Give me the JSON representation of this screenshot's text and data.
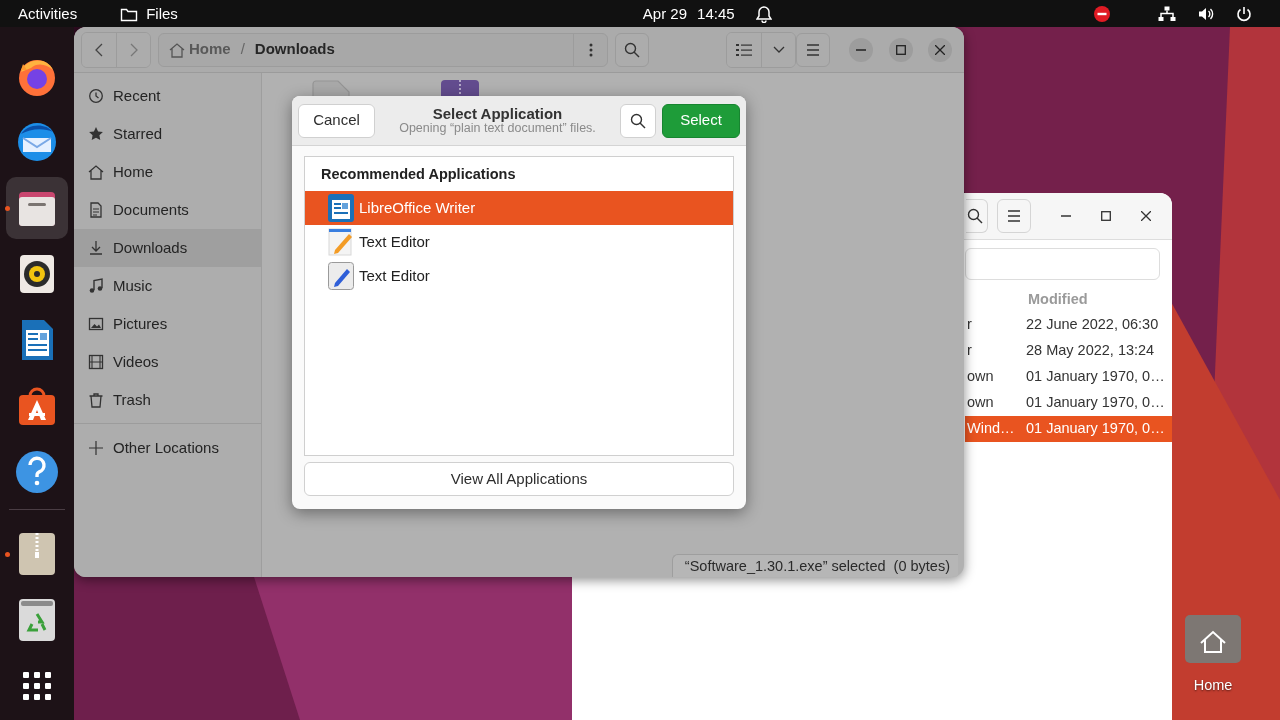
{
  "top_bar": {
    "activities": "Activities",
    "app_menu": "Files",
    "date": "Apr 29",
    "time": "14:45"
  },
  "dock": {
    "pinned": [
      {
        "kind": "browser",
        "running": false,
        "selected": false
      },
      {
        "kind": "mail",
        "running": false,
        "selected": false
      },
      {
        "kind": "files",
        "running": true,
        "selected": true
      },
      {
        "kind": "music",
        "running": false,
        "selected": false
      },
      {
        "kind": "writer",
        "running": false,
        "selected": false
      },
      {
        "kind": "store",
        "running": false,
        "selected": false
      },
      {
        "kind": "help",
        "running": false,
        "selected": false
      }
    ],
    "others": [
      {
        "kind": "archive",
        "running": true,
        "selected": false
      },
      {
        "kind": "trash",
        "running": false,
        "selected": false
      }
    ]
  },
  "files_window": {
    "path": [
      {
        "label": "Home",
        "current": false
      },
      {
        "separator": "/",
        "label": "Downloads",
        "current": true
      }
    ],
    "sidebar": {
      "items": [
        {
          "kind": "recent",
          "label": "Recent",
          "selected": false
        },
        {
          "kind": "starred",
          "label": "Starred",
          "selected": false
        },
        {
          "kind": "home",
          "label": "Home",
          "selected": false
        },
        {
          "kind": "documents",
          "label": "Documents",
          "selected": false
        },
        {
          "kind": "downloads",
          "label": "Downloads",
          "selected": true
        },
        {
          "kind": "music",
          "label": "Music",
          "selected": false
        },
        {
          "kind": "pictures",
          "label": "Pictures",
          "selected": false
        },
        {
          "kind": "videos",
          "label": "Videos",
          "selected": false
        },
        {
          "kind": "trash",
          "label": "Trash",
          "selected": false
        },
        {
          "kind": "other",
          "label": "Other Locations",
          "selected": false
        }
      ]
    },
    "status_bar": "“Software_1.30.1.exe” selected  (0 bytes)"
  },
  "dialog": {
    "cancel": "Cancel",
    "title": "Select Application",
    "subtitle": "Opening “plain text document” files.",
    "select": "Select",
    "section": "Recommended Applications",
    "apps": [
      {
        "kind": "writer",
        "name": "LibreOffice Writer",
        "selected": true
      },
      {
        "kind": "editor",
        "name": "Text Editor",
        "selected": false
      },
      {
        "kind": "editor2",
        "name": "Text Editor",
        "selected": false
      }
    ],
    "view_all": "View All Applications"
  },
  "back_window": {
    "column_header": "Modified",
    "rows": [
      {
        "column_1": "r",
        "modified": "22 June 2022, 06:30",
        "selected": false
      },
      {
        "column_1": "r",
        "modified": "28 May 2022, 13:24",
        "selected": false
      },
      {
        "column_1": "own",
        "modified": "01 January 1970, 0…",
        "selected": false
      },
      {
        "column_1": "own",
        "modified": "01 January 1970, 0…",
        "selected": false
      },
      {
        "column_1": "Wind…",
        "modified": "01 January 1970, 0…",
        "selected": true
      }
    ]
  },
  "desktop_icons": [
    {
      "label": "Home"
    }
  ]
}
